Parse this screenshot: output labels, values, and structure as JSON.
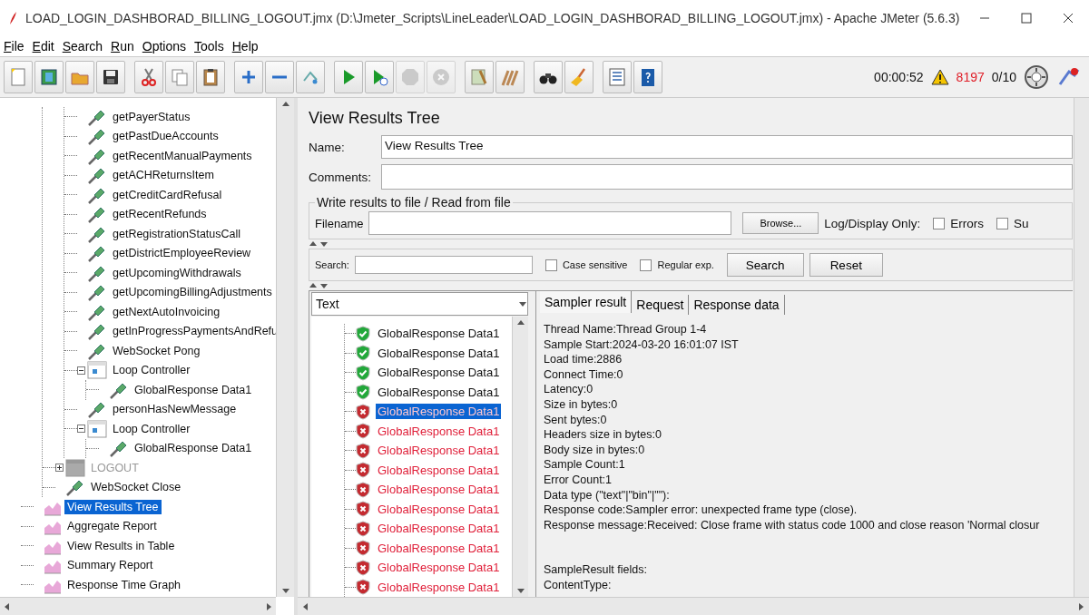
{
  "window": {
    "title": "LOAD_LOGIN_DASHBORAD_BILLING_LOGOUT.jmx (D:\\Jmeter_Scripts\\LineLeader\\LOAD_LOGIN_DASHBORAD_BILLING_LOGOUT.jmx) - Apache JMeter (5.6.3)"
  },
  "menu": [
    {
      "label": "File"
    },
    {
      "label": "Edit"
    },
    {
      "label": "Search"
    },
    {
      "label": "Run"
    },
    {
      "label": "Options"
    },
    {
      "label": "Tools"
    },
    {
      "label": "Help"
    }
  ],
  "toolbar": {
    "buttons": [
      {
        "kind": "new",
        "disabled": false
      },
      {
        "kind": "templates",
        "disabled": false
      },
      {
        "kind": "open",
        "disabled": false
      },
      {
        "kind": "save",
        "disabled": false
      },
      {
        "kind": "cut",
        "disabled": false
      },
      {
        "kind": "copy",
        "disabled": false
      },
      {
        "kind": "paste",
        "disabled": false
      },
      {
        "kind": "expand",
        "disabled": false
      },
      {
        "kind": "collapse",
        "disabled": false
      },
      {
        "kind": "toggle",
        "disabled": false
      },
      {
        "kind": "start",
        "disabled": false
      },
      {
        "kind": "start_no_pause",
        "disabled": false
      },
      {
        "kind": "stop",
        "disabled": true
      },
      {
        "kind": "shutdown",
        "disabled": true
      },
      {
        "kind": "clear",
        "disabled": false
      },
      {
        "kind": "clear_all",
        "disabled": false
      },
      {
        "kind": "search",
        "disabled": false
      },
      {
        "kind": "reset_search",
        "disabled": false
      },
      {
        "kind": "function_helper",
        "disabled": false
      },
      {
        "kind": "help",
        "disabled": false
      }
    ],
    "elapsed": "00:00:52",
    "error_count": "8197",
    "threads": "0/10"
  },
  "tree": {
    "items": [
      {
        "children": [
          {
            "children": [
              {
                "label": "getPayerStatus",
                "kind": "sampler",
                "selected": false
              },
              {
                "label": "getPastDueAccounts",
                "kind": "sampler",
                "selected": false
              },
              {
                "label": "getRecentManualPayments",
                "kind": "sampler",
                "selected": false
              },
              {
                "label": "getACHReturnsItem",
                "kind": "sampler",
                "selected": false
              },
              {
                "label": "getCreditCardRefusal",
                "kind": "sampler",
                "selected": false
              },
              {
                "label": "getRecentRefunds",
                "kind": "sampler",
                "selected": false
              },
              {
                "label": "getRegistrationStatusCall",
                "kind": "sampler",
                "selected": false
              },
              {
                "label": "getDistrictEmployeeReview",
                "kind": "sampler",
                "selected": false
              },
              {
                "label": "getUpcomingWithdrawals",
                "kind": "sampler",
                "selected": false
              },
              {
                "label": "getUpcomingBillingAdjustments",
                "kind": "sampler",
                "selected": false
              },
              {
                "label": "getNextAutoInvoicing",
                "kind": "sampler",
                "selected": false
              },
              {
                "label": "getInProgressPaymentsAndRefu",
                "kind": "sampler",
                "selected": false
              },
              {
                "label": "WebSocket Pong",
                "kind": "sampler",
                "selected": false
              },
              {
                "label": "Loop Controller",
                "kind": "controller",
                "selected": false,
                "expanded": true,
                "disabled": false,
                "children": [
                  {
                    "label": "GlobalResponse Data1",
                    "kind": "sampler",
                    "selected": false
                  }
                ]
              },
              {
                "label": "personHasNewMessage",
                "kind": "sampler",
                "selected": false
              },
              {
                "label": "Loop Controller",
                "kind": "controller",
                "selected": false,
                "expanded": true,
                "disabled": false,
                "children": [
                  {
                    "label": "GlobalResponse Data1",
                    "kind": "sampler",
                    "selected": false
                  }
                ]
              }
            ]
          },
          {
            "label": "LOGOUT",
            "kind": "controller",
            "selected": false,
            "expanded": false,
            "disabled": true
          },
          {
            "label": "WebSocket Close",
            "kind": "sampler",
            "selected": false
          }
        ]
      },
      {
        "label": "View Results Tree",
        "kind": "listener",
        "selected": true
      },
      {
        "label": "Aggregate Report",
        "kind": "listener",
        "selected": false
      },
      {
        "label": "View Results in Table",
        "kind": "listener",
        "selected": false
      },
      {
        "label": "Summary Report",
        "kind": "listener",
        "selected": false
      },
      {
        "label": "Response Time Graph",
        "kind": "listener",
        "selected": false
      }
    ]
  },
  "panel": {
    "title": "View Results Tree",
    "name_label": "Name:",
    "name_value": "View Results Tree",
    "comments_label": "Comments:",
    "file_group": {
      "legend": "Write results to file / Read from file",
      "filename_label": "Filename",
      "browse": "Browse...",
      "log_label": "Log/Display Only:",
      "options": [
        {
          "label": "Errors",
          "checked": false
        },
        {
          "label": "Su",
          "checked": false
        }
      ]
    },
    "search": {
      "label": "Search:",
      "options": [
        {
          "label": "Case sensitive",
          "checked": false
        },
        {
          "label": "Regular exp.",
          "checked": false
        }
      ],
      "search_button": "Search",
      "reset_button": "Reset"
    },
    "renderer": "Text",
    "results": [
      {
        "label": "GlobalResponse Data1",
        "success": true,
        "selected": false
      },
      {
        "label": "GlobalResponse Data1",
        "success": true,
        "selected": false
      },
      {
        "label": "GlobalResponse Data1",
        "success": true,
        "selected": false
      },
      {
        "label": "GlobalResponse Data1",
        "success": true,
        "selected": false
      },
      {
        "label": "GlobalResponse Data1",
        "success": false,
        "selected": true
      },
      {
        "label": "GlobalResponse Data1",
        "success": false,
        "selected": false
      },
      {
        "label": "GlobalResponse Data1",
        "success": false,
        "selected": false
      },
      {
        "label": "GlobalResponse Data1",
        "success": false,
        "selected": false
      },
      {
        "label": "GlobalResponse Data1",
        "success": false,
        "selected": false
      },
      {
        "label": "GlobalResponse Data1",
        "success": false,
        "selected": false
      },
      {
        "label": "GlobalResponse Data1",
        "success": false,
        "selected": false
      },
      {
        "label": "GlobalResponse Data1",
        "success": false,
        "selected": false
      },
      {
        "label": "GlobalResponse Data1",
        "success": false,
        "selected": false
      },
      {
        "label": "GlobalResponse Data1",
        "success": false,
        "selected": false
      }
    ],
    "tabs": [
      {
        "label": "Sampler result",
        "selected": true
      },
      {
        "label": "Request",
        "selected": false
      },
      {
        "label": "Response data",
        "selected": false
      }
    ],
    "sections": [
      [
        "Thread Name:Thread Group 1-4",
        "Sample Start:2024-03-20 16:01:07 IST",
        "Load time:2886",
        "Connect Time:0",
        "Latency:0",
        "Size in bytes:0",
        "Sent bytes:0",
        "Headers size in bytes:0",
        "Body size in bytes:0",
        "Sample Count:1",
        "Error Count:1",
        "Data type (\"text\"|\"bin\"|\"\"):",
        "Response code:Sampler error: unexpected frame type (close).",
        "Response message:Received: Close frame with status code 1000 and close reason 'Normal closur"
      ],
      [
        "SampleResult fields:",
        "ContentType:"
      ]
    ]
  }
}
